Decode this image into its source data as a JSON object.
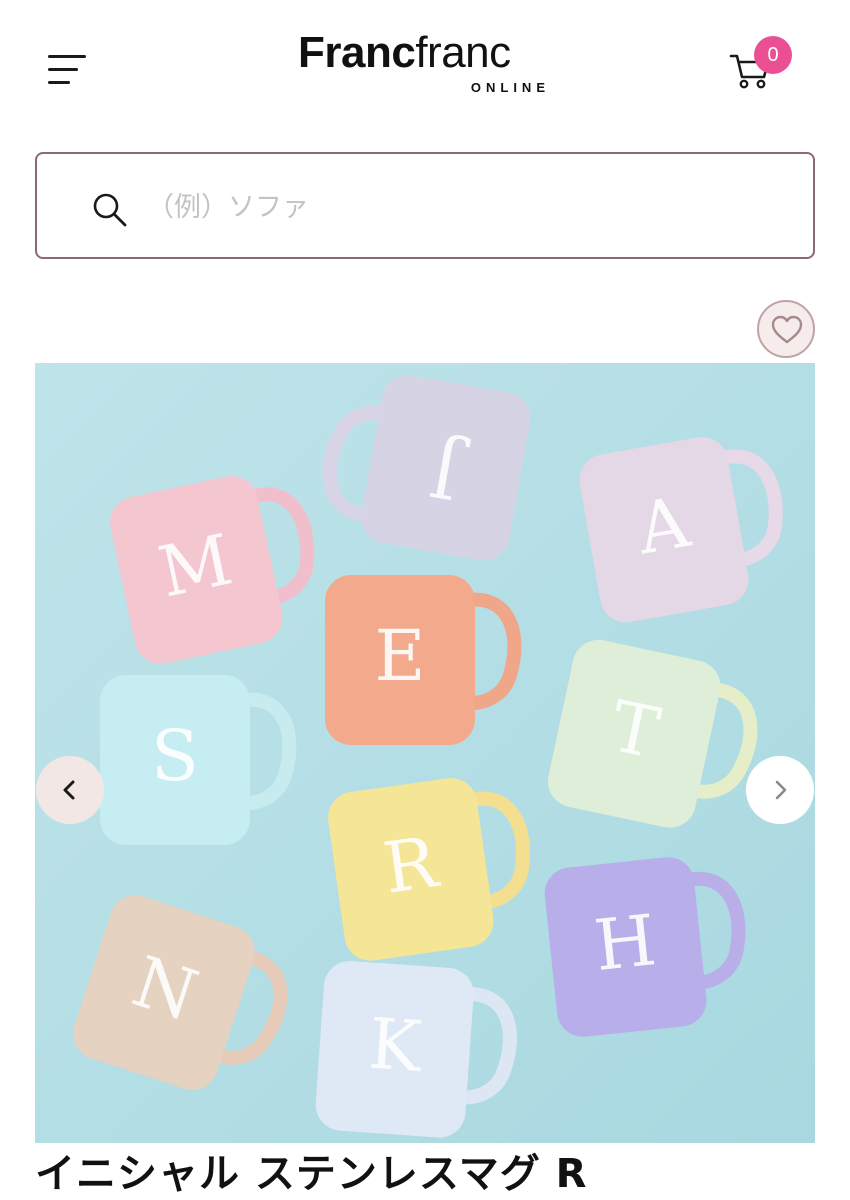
{
  "header": {
    "logo_bold": "Franc",
    "logo_thin": "franc",
    "logo_sub": "ONLINE",
    "cart_count": "0",
    "menu_icon": "hamburger-menu-icon",
    "cart_icon": "shopping-cart-icon"
  },
  "search": {
    "placeholder": "（例）ソファ",
    "value": "",
    "icon": "search-icon"
  },
  "favorite": {
    "icon": "heart-icon"
  },
  "gallery": {
    "mug_letters": [
      "M",
      "J",
      "A",
      "E",
      "S",
      "T",
      "R",
      "N",
      "K",
      "H"
    ],
    "prev_icon": "chevron-left-icon",
    "next_icon": "chevron-right-icon"
  },
  "product": {
    "title": "イニシャル ステンレスマグ R"
  },
  "colors": {
    "brand_pink": "#ea4f93",
    "search_border": "#8d6a6e",
    "photo_background": "#b5dfe6"
  }
}
